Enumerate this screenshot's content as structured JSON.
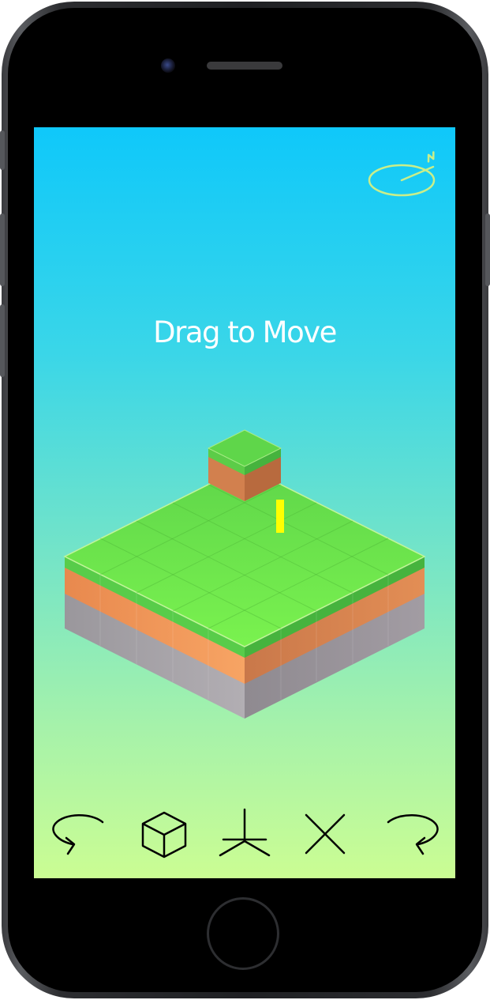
{
  "game": {
    "hint_text": "Drag to Move",
    "compass": {
      "icon": "compass-north-icon",
      "label": "N"
    }
  },
  "toolbar": [
    {
      "name": "rotate-left-button",
      "icon": "rotate-left-icon"
    },
    {
      "name": "cube-button",
      "icon": "cube-icon"
    },
    {
      "name": "axis-button",
      "icon": "axis-icon"
    },
    {
      "name": "close-button",
      "icon": "close-icon"
    },
    {
      "name": "rotate-right-button",
      "icon": "rotate-right-icon"
    }
  ],
  "colors": {
    "sky_top": "#0fc8fa",
    "sky_bottom": "#cbfd93",
    "grass_top": "#6fe552",
    "grass_side": "#52c94a",
    "dirt": "#f39a5e",
    "stone": "#a6a2a8",
    "marker": "#ffff00",
    "compass": "#c9ee8a"
  }
}
